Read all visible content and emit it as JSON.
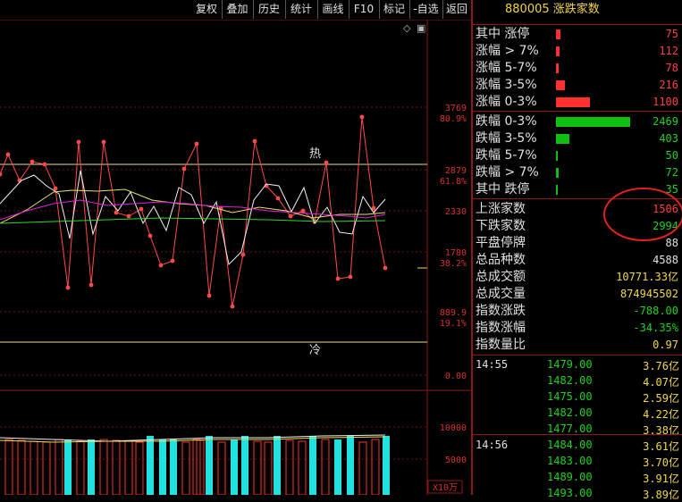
{
  "toolbar": {
    "buttons": [
      "复权",
      "叠加",
      "历史",
      "统计",
      "画线",
      "F10",
      "标记",
      "-自选",
      "返回"
    ]
  },
  "title": "880005 涨跌家数",
  "chart": {
    "top_icons": [
      "◇",
      "▣"
    ],
    "hot_label": "热",
    "cold_label": "冷",
    "axis": [
      {
        "value": "3769",
        "pct": "80.9%"
      },
      {
        "value": "2879",
        "pct": "61.8%"
      },
      {
        "value": "2330",
        "pct": ""
      },
      {
        "value": "1780",
        "pct": "38.2%"
      },
      {
        "value": "889.9",
        "pct": "19.1%"
      },
      {
        "value": "0.00",
        "pct": ""
      }
    ],
    "vol_axis": [
      "10000",
      "5000"
    ],
    "vol_unit": "X10万"
  },
  "stats": {
    "up_rows": [
      {
        "label": "其中 涨停",
        "value": "75",
        "bar": 5
      },
      {
        "label": "涨幅 > 7%",
        "value": "112",
        "bar": 4
      },
      {
        "label": "涨幅 5-7%",
        "value": "78",
        "bar": 3
      },
      {
        "label": "涨幅 3-5%",
        "value": "216",
        "bar": 10
      },
      {
        "label": "涨幅 0-3%",
        "value": "1100",
        "bar": 38
      }
    ],
    "down_rows": [
      {
        "label": "跌幅 0-3%",
        "value": "2469",
        "bar": 83
      },
      {
        "label": "跌幅 3-5%",
        "value": "403",
        "bar": 15
      },
      {
        "label": "跌幅 5-7%",
        "value": "50",
        "bar": 2
      },
      {
        "label": "跌幅 > 7%",
        "value": "72",
        "bar": 3
      },
      {
        "label": "其中 跌停",
        "value": "35",
        "bar": 2
      }
    ],
    "summary": [
      {
        "label": "上涨家数",
        "value": "1506",
        "color": "#ff4040"
      },
      {
        "label": "下跌家数",
        "value": "2994",
        "color": "#1fd21f"
      },
      {
        "label": "平盘停牌",
        "value": "88",
        "color": "#e0e0e0"
      },
      {
        "label": "总品种数",
        "value": "4588",
        "color": "#e0e0e0"
      },
      {
        "label": "总成交额",
        "value": "10771.33亿",
        "color": "#f2d64a"
      },
      {
        "label": "总成交量",
        "value": "874945502",
        "color": "#f2d64a"
      },
      {
        "label": "指数涨跌",
        "value": "-788.00",
        "color": "#1fd21f"
      },
      {
        "label": "指数涨幅",
        "value": "-34.35%",
        "color": "#1fd21f"
      },
      {
        "label": "指数量比",
        "value": "0.97",
        "color": "#f2d64a"
      }
    ]
  },
  "ticks": [
    {
      "time": "14:55",
      "price": "1479.00",
      "amt": "3.76亿"
    },
    {
      "time": "",
      "price": "1482.00",
      "amt": "4.07亿"
    },
    {
      "time": "",
      "price": "1475.00",
      "amt": "2.59亿"
    },
    {
      "time": "",
      "price": "1482.00",
      "amt": "4.22亿"
    },
    {
      "time": "",
      "price": "1477.00",
      "amt": "3.38亿"
    },
    {
      "time": "14:56",
      "price": "1484.00",
      "amt": "3.61亿"
    },
    {
      "time": "",
      "price": "1483.00",
      "amt": "3.70亿"
    },
    {
      "time": "",
      "price": "1489.00",
      "amt": "3.91亿"
    },
    {
      "time": "",
      "price": "1493.00",
      "amt": "3.89亿"
    }
  ],
  "colors": {
    "up": "#ff4040",
    "down": "#1fd21f",
    "accent": "#f2d64a",
    "grid": "#8b1a1a"
  }
}
